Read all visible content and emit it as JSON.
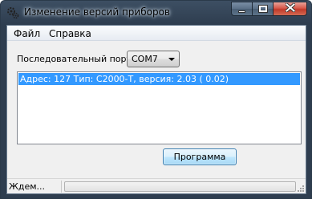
{
  "window": {
    "title": "Изменение версий приборов",
    "icon": "gears-icon"
  },
  "caption": {
    "minimize": "minimize-icon",
    "maximize": "maximize-icon",
    "close": "close-icon"
  },
  "menu": {
    "items": [
      "Файл",
      "Справка"
    ]
  },
  "port": {
    "label": "Последовательный порт:",
    "value": "COM7"
  },
  "devices": {
    "items": [
      "Адрес: 127 Тип: С2000-Т, версия: 2.03 ( 0.02)"
    ]
  },
  "actions": {
    "program_label": "Программа"
  },
  "status": {
    "text": "Ждем...",
    "progress_percent": 0
  },
  "colors": {
    "selection": "#3399ff",
    "progress": "#37c41c"
  }
}
